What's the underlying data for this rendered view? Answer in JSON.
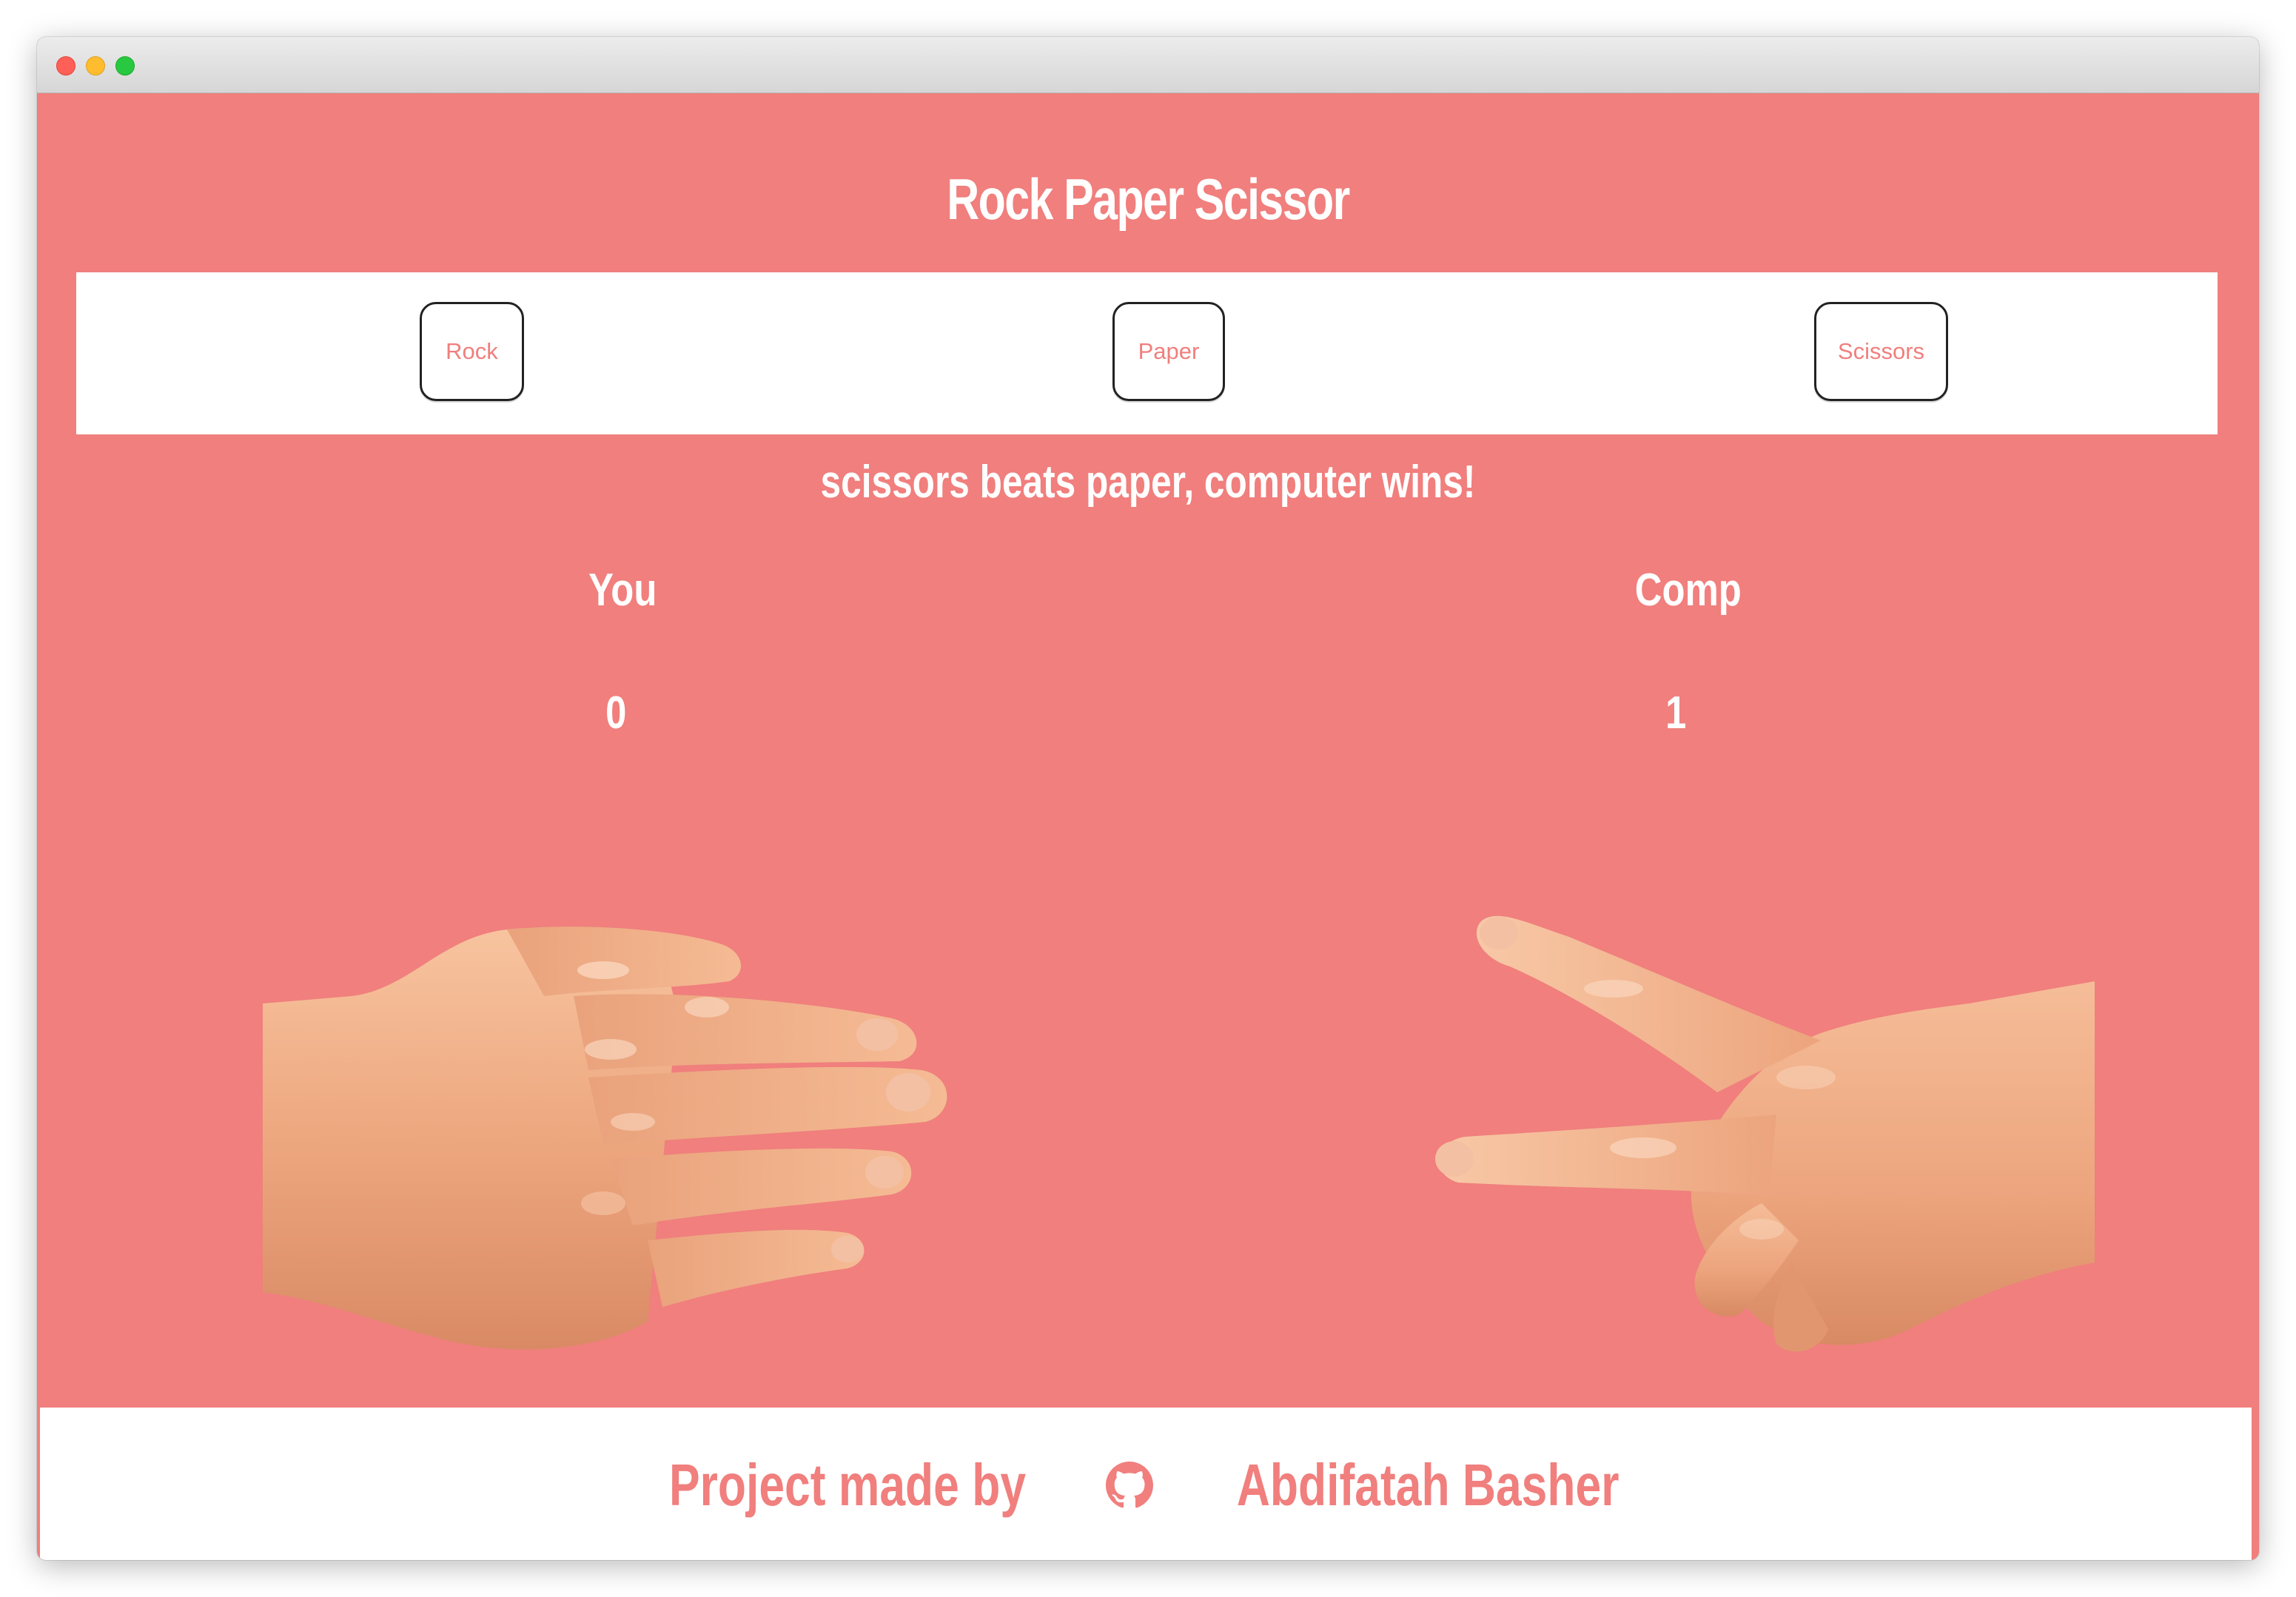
{
  "app": {
    "title": "Rock Paper Scissor",
    "accent_color": "#f07f7d",
    "choices": {
      "rock": "Rock",
      "paper": "Paper",
      "scissors": "Scissors"
    },
    "result_message": "scissors beats paper, computer wins!",
    "players": {
      "you_label": "You",
      "comp_label": "Comp",
      "you_score": "0",
      "comp_score": "1"
    },
    "hands": {
      "you_choice_icon": "paper-hand-icon",
      "comp_choice_icon": "scissors-hand-icon"
    }
  },
  "footer": {
    "made_by_label": "Project made by",
    "author_name": "Abdifatah Basher",
    "link_icon": "github-icon"
  }
}
